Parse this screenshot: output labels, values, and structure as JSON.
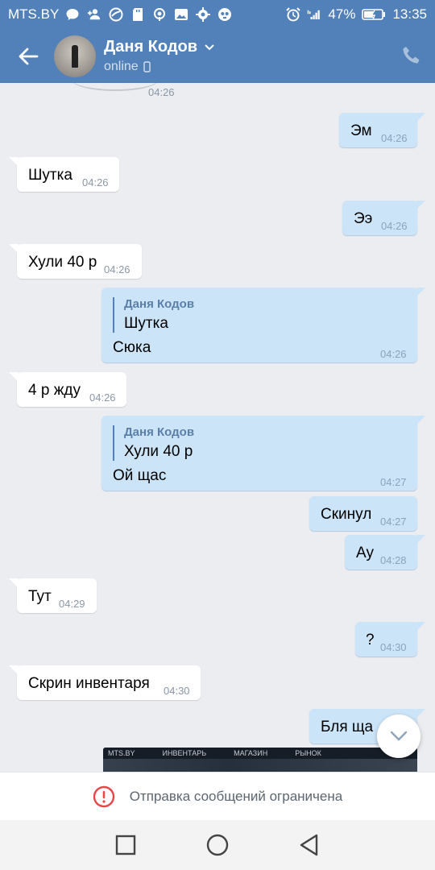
{
  "status_bar": {
    "carrier": "MTS.BY",
    "battery": "47%",
    "time": "13:35"
  },
  "header": {
    "name": "Даня Кодов",
    "status": "online"
  },
  "top_time": "04:26",
  "messages": [
    {
      "dir": "out",
      "text": "Эм",
      "time": "04:26"
    },
    {
      "dir": "in",
      "text": "Шутка",
      "time": "04:26"
    },
    {
      "dir": "out",
      "text": "Ээ",
      "time": "04:26"
    },
    {
      "dir": "in",
      "text": "Хули 40 р",
      "time": "04:26"
    },
    {
      "dir": "out",
      "reply_name": "Даня Кодов",
      "reply_text": "Шутка",
      "text": "Сюка",
      "time": "04:26"
    },
    {
      "dir": "in",
      "text": "4 р жду",
      "time": "04:26"
    },
    {
      "dir": "out",
      "reply_name": "Даня Кодов",
      "reply_text": "Хули 40 р",
      "text": "Ой щас",
      "time": "04:27"
    },
    {
      "dir": "out",
      "text": "Скинул",
      "time": "04:27"
    },
    {
      "dir": "out",
      "text": "Ау",
      "time": "04:28"
    },
    {
      "dir": "in",
      "text": "Тут",
      "time": "04:29"
    },
    {
      "dir": "out",
      "text": "?",
      "time": "04:30"
    },
    {
      "dir": "in",
      "text": "Скрин инвентаря",
      "time": "04:30"
    },
    {
      "dir": "out",
      "text": "Бля ща",
      "time": ""
    }
  ],
  "screenshot_preview": {
    "labels": [
      "MTS.BY",
      "ИНВЕНТАРЬ",
      "МАГАЗИН",
      "РЫНОК"
    ]
  },
  "restriction_text": "Отправка сообщений ограничена",
  "colors": {
    "accent": "#5181b8",
    "incoming_bubble": "#ffffff",
    "outgoing_bubble": "#cce4f7",
    "background": "#ebedf0",
    "warning": "#e64646"
  }
}
